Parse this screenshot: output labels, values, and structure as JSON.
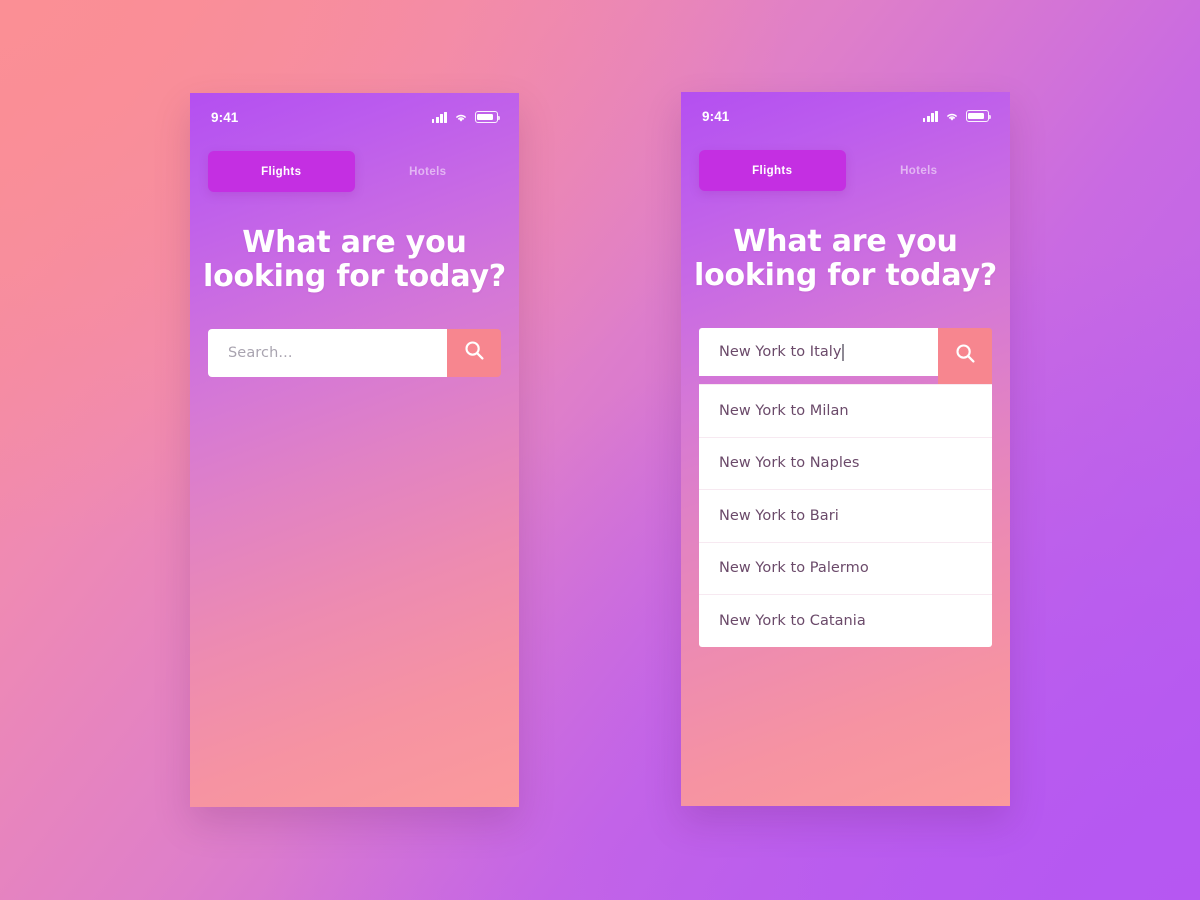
{
  "canvas": {
    "background_gradient_from": "#f98d96",
    "background_gradient_to": "#b45ef0"
  },
  "theme": {
    "accent_tab": "#c42fe2",
    "accent_search_button": "#f7868f",
    "card_background": "#ffffff",
    "body_text": "#6b4a6a",
    "placeholder_text": "#a9a4b0",
    "divider": "#f7e9f1",
    "heading_text": "#ffffff"
  },
  "screens": [
    {
      "id": "empty-state",
      "status_bar": {
        "time": "9:41",
        "icons": [
          "signal-icon",
          "wifi-icon",
          "battery-icon"
        ]
      },
      "tabs": [
        {
          "label": "Flights",
          "active": true
        },
        {
          "label": "Hotels",
          "active": false
        }
      ],
      "heading": {
        "line1": "What are you",
        "line2": "looking for today?"
      },
      "search": {
        "value": "",
        "placeholder": "Search...",
        "button_icon": "search-icon",
        "show_caret": false
      },
      "suggestions": []
    },
    {
      "id": "typing-state",
      "status_bar": {
        "time": "9:41",
        "icons": [
          "signal-icon",
          "wifi-icon",
          "battery-icon"
        ]
      },
      "tabs": [
        {
          "label": "Flights",
          "active": true
        },
        {
          "label": "Hotels",
          "active": false
        }
      ],
      "heading": {
        "line1": "What are you",
        "line2": "looking for today?"
      },
      "search": {
        "value": "New York to Italy",
        "placeholder": "Search...",
        "button_icon": "search-icon",
        "show_caret": true
      },
      "suggestions": [
        "New York to Milan",
        "New York to Naples",
        "New York to Bari",
        "New York to Palermo",
        "New York to Catania"
      ]
    }
  ]
}
